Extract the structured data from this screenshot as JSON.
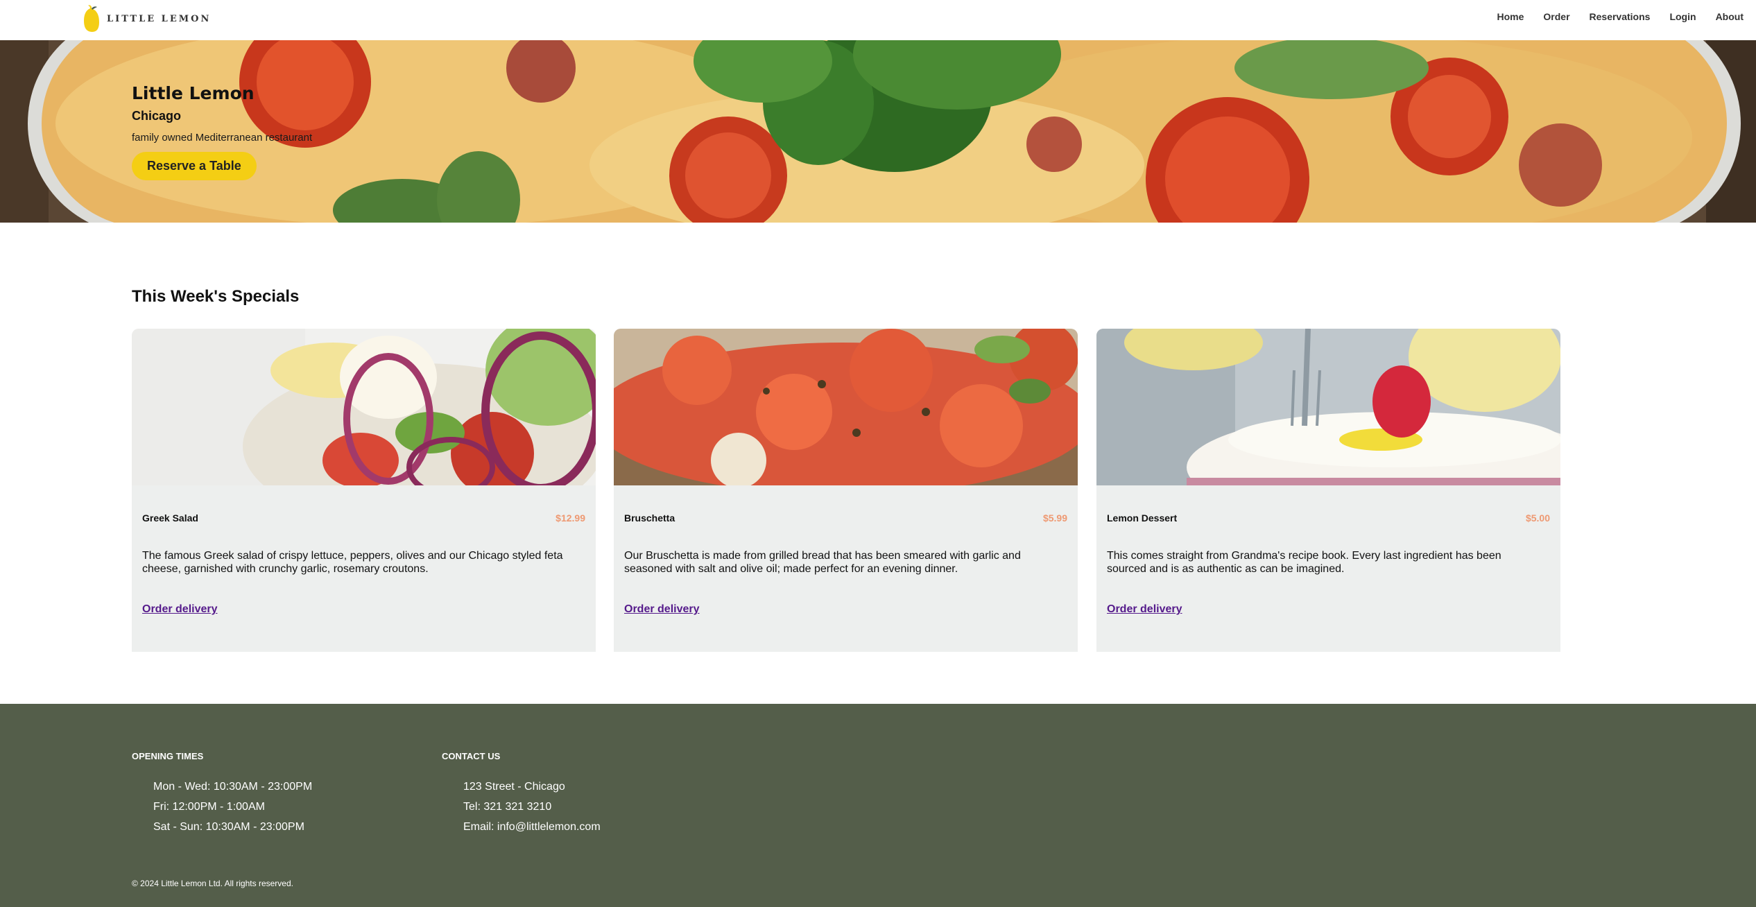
{
  "nav": {
    "logo_text": "LITTLE LEMON",
    "links": [
      "Home",
      "Order",
      "Reservations",
      "Login",
      "About"
    ]
  },
  "hero": {
    "title": "Little Lemon",
    "subtitle": "Chicago",
    "description": "family owned Mediterranean restaurant",
    "button_label": "Reserve a Table"
  },
  "specials": {
    "title": "This Week's Specials",
    "cards": [
      {
        "name": "Greek Salad",
        "price": "$12.99",
        "description": "The famous Greek salad of crispy lettuce, peppers, olives and our Chicago styled feta cheese, garnished with crunchy garlic, rosemary croutons.",
        "link": "Order delivery"
      },
      {
        "name": "Bruschetta",
        "price": "$5.99",
        "description": "Our Bruschetta is made from grilled bread that has been smeared with garlic and seasoned with salt and olive oil; made perfect for an evening dinner.",
        "link": "Order delivery"
      },
      {
        "name": "Lemon Dessert",
        "price": "$5.00",
        "description": "This comes straight from Grandma's recipe book. Every last ingredient has been sourced and is as authentic as can be imagined.",
        "link": "Order delivery"
      }
    ]
  },
  "footer": {
    "opening_title": "OPENING TIMES",
    "opening": [
      "Mon - Wed: 10:30AM - 23:00PM",
      "Fri: 12:00PM - 1:00AM",
      "Sat - Sun: 10:30AM - 23:00PM"
    ],
    "contact_title": "CONTACT US",
    "contact": [
      "123 Street - Chicago",
      "Tel: 321 321 3210",
      "Email: info@littlelemon.com"
    ],
    "copyright": "© 2024 Little Lemon Ltd. All rights reserved."
  },
  "colors": {
    "accent_yellow": "#f4ce14",
    "price_orange": "#ee9972",
    "footer_green": "#545e4a",
    "card_bg": "#edefee"
  }
}
